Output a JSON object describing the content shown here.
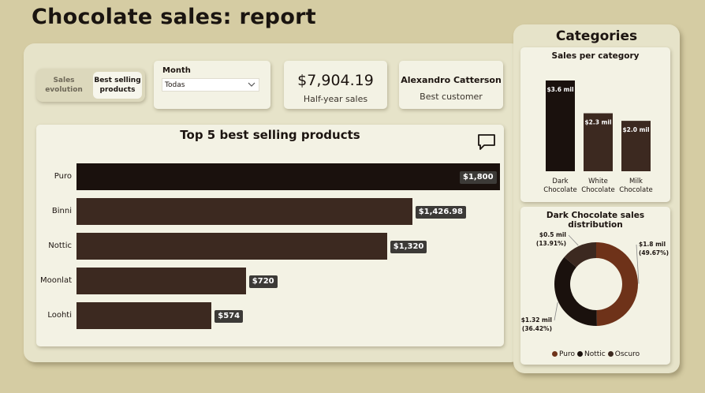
{
  "page": {
    "title": "Chocolate sales: report"
  },
  "toggle": {
    "option_1": "Sales\nevolution",
    "option_2": "Best selling\nproducts"
  },
  "month_filter": {
    "label": "Month",
    "value": "Todas"
  },
  "kpis": {
    "sales_value": "$7,904.19",
    "sales_label": "Half-year sales",
    "customer_name": "Alexandro Catterson",
    "customer_label": "Best customer"
  },
  "top5": {
    "title": "Top 5 best selling products",
    "chart_data": {
      "type": "bar",
      "orientation": "horizontal",
      "categories": [
        "Puro",
        "Binni",
        "Nottic",
        "Moonlat",
        "Loohti"
      ],
      "values": [
        1800,
        1426.98,
        1320,
        720,
        574
      ],
      "data_labels": [
        "$1,800",
        "$1,426.98",
        "$1,320",
        "$720",
        "$574"
      ],
      "xlim": [
        0,
        1800
      ]
    }
  },
  "side": {
    "title": "Categories",
    "category_chart": {
      "title": "Sales per category",
      "chart_data": {
        "type": "bar",
        "categories": [
          "Dark\nChocolate",
          "White\nChocolate",
          "Milk\nChocolate"
        ],
        "values": [
          3.6,
          2.3,
          2.0
        ],
        "data_labels": [
          "$3.6 mil",
          "$2.3 mil",
          "$2.0 mil"
        ],
        "ylim": [
          0,
          3.6
        ]
      }
    },
    "dist_chart": {
      "title": "Dark Chocolate sales distribution",
      "chart_data": {
        "type": "pie",
        "donut": true,
        "labels": [
          "Puro",
          "Nottic",
          "Oscuro"
        ],
        "values": [
          1.8,
          1.32,
          0.5
        ],
        "percentages": [
          49.67,
          36.42,
          13.91
        ],
        "value_labels": [
          "$1.8 mil",
          "$1.32 mil",
          "$0.5 mil"
        ],
        "pct_labels": [
          "(49.67%)",
          "(36.42%)",
          "(13.91%)"
        ],
        "legend": "bottom"
      }
    }
  },
  "colors": {
    "background": "#d5cca3",
    "panel": "#e6e3c9",
    "card": "#f3f2e4",
    "bar_dark": "#1a110d",
    "bar": "#3c2920",
    "puro": "#6e3219",
    "nottic": "#1a110d",
    "oscuro": "#3c2920"
  },
  "icons": {
    "comment": "comment-icon",
    "dropdown": "chevron-down-icon"
  }
}
